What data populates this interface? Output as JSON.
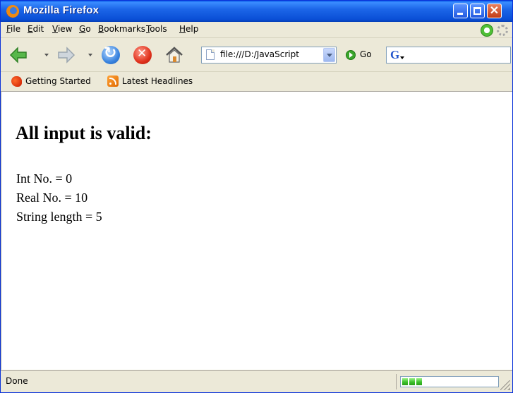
{
  "window": {
    "title": "Mozilla Firefox"
  },
  "menu": {
    "items": [
      "File",
      "Edit",
      "View",
      "Go",
      "Bookmarks",
      "Tools",
      "Help"
    ]
  },
  "navigation": {
    "url": "file:///D:/JavaScript",
    "go_label": "Go",
    "search_engine_glyph": "G"
  },
  "bookmarks": {
    "items": [
      "Getting Started",
      "Latest Headlines"
    ]
  },
  "page": {
    "heading": "All input is valid:",
    "lines": [
      "Int No. = 0",
      "Real No. = 10",
      "String length = 5"
    ]
  },
  "status": {
    "text": "Done",
    "progress_segments_filled": 3
  },
  "colors": {
    "titlebar": "#0a4fd6",
    "close_button": "#c23d15",
    "progress": "#3cc12a"
  }
}
